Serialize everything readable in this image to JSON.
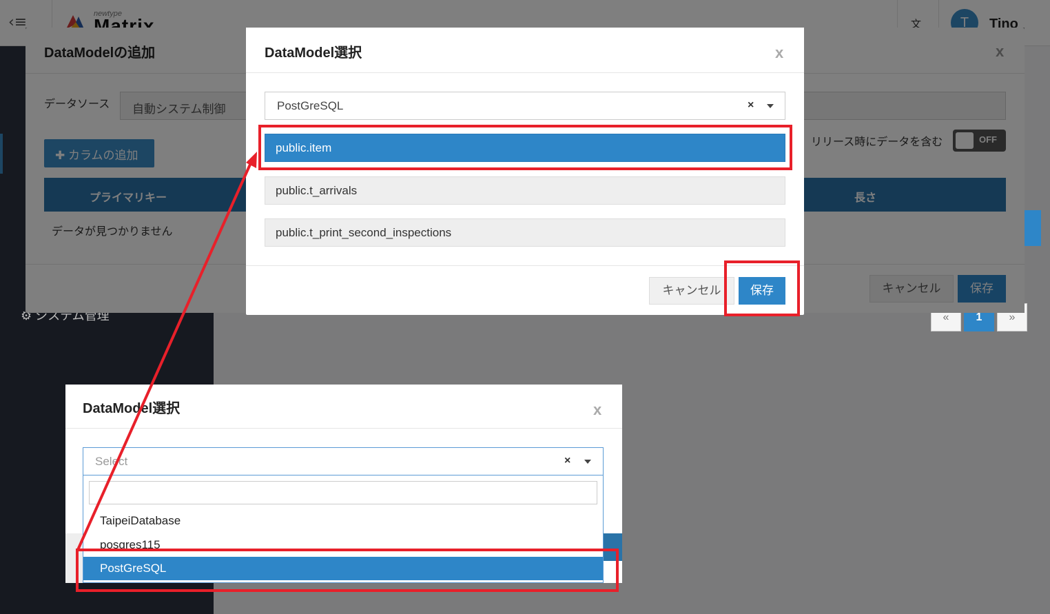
{
  "app": {
    "logo_tagline": "newtype",
    "logo_text": "Matrix",
    "user_initial": "T",
    "user_name": "Tino",
    "sidebar_system_label": "システム管理"
  },
  "back_modal": {
    "title": "DataModelの追加",
    "close": "x",
    "datasource_label": "データソース",
    "datasource_value": "自動システム制御",
    "add_column_button": "✚ カラムの追加",
    "release_label": "リリース時にデータを含む",
    "toggle_text": "OFF",
    "table_headers": [
      "プライマリキー",
      "長さ"
    ],
    "empty_text": "データが見つかりません",
    "cancel_button": "キャンセル",
    "save_button": "保存"
  },
  "pagination": {
    "prev": "«",
    "current": "1",
    "next": "»"
  },
  "top_modal": {
    "title": "DataModel選択",
    "close": "x",
    "selected_source": "PostGreSQL",
    "clear_glyph": "×",
    "items": [
      {
        "label": "public.item",
        "selected": true
      },
      {
        "label": "public.t_arrivals",
        "selected": false
      },
      {
        "label": "public.t_print_second_inspections",
        "selected": false
      }
    ],
    "cancel_button": "キャンセル",
    "save_button": "保存"
  },
  "lower_modal": {
    "title": "DataModel選択",
    "close": "x",
    "placeholder": "Select",
    "clear_glyph": "×",
    "options": [
      {
        "label": "TaipeiDatabase",
        "selected": false
      },
      {
        "label": "posgres115",
        "selected": false
      },
      {
        "label": "PostGreSQL",
        "selected": true
      }
    ]
  },
  "annotation_color": "#e8202a",
  "accent_color": "#2e86c8"
}
